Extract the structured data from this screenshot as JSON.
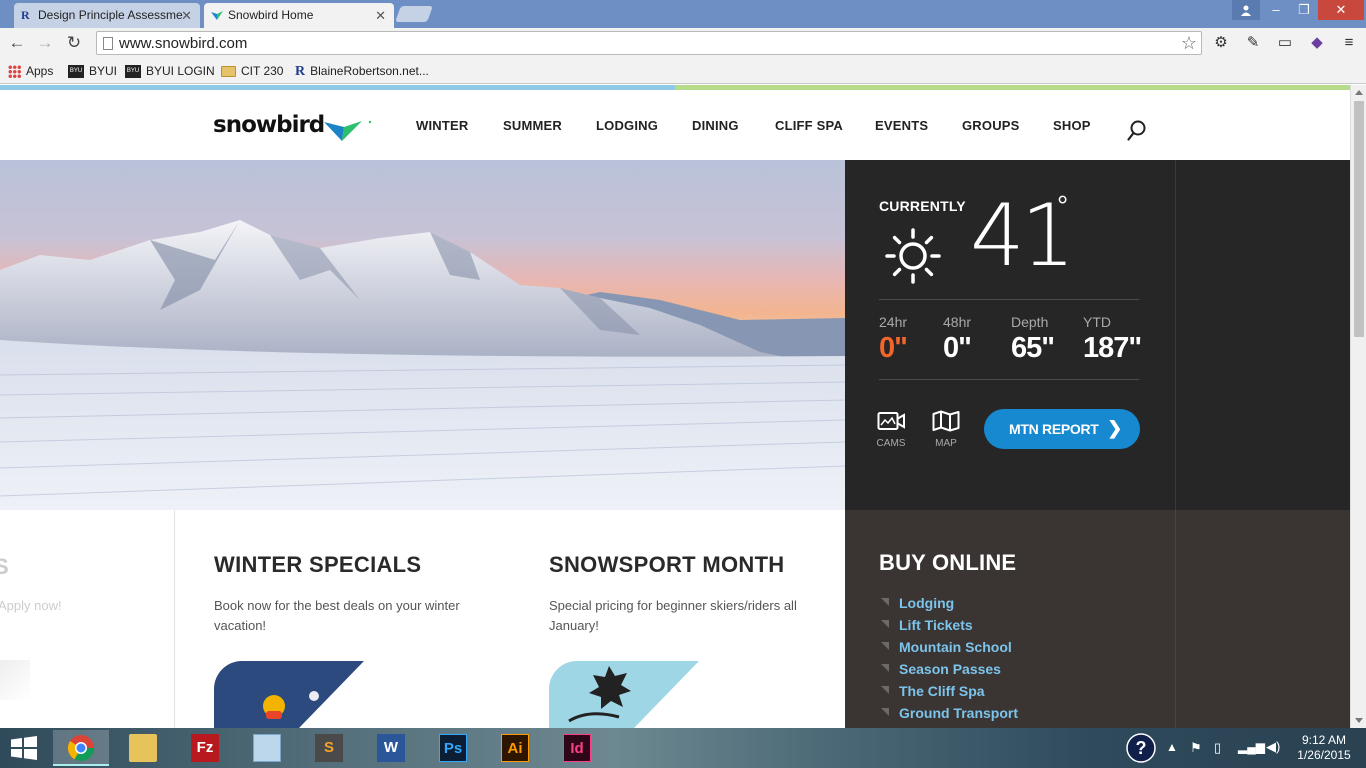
{
  "browser": {
    "tabs": [
      {
        "title": "Design Principle Assessme",
        "active": false
      },
      {
        "title": "Snowbird Home",
        "active": true
      }
    ],
    "url": "www.snowbird.com",
    "bookmarks": [
      {
        "label": "Apps",
        "icon": "apps-grid-icon"
      },
      {
        "label": "BYUI",
        "icon": "byui-logo-icon"
      },
      {
        "label": "BYUI LOGIN",
        "icon": "byui-logo-icon"
      },
      {
        "label": "CIT 230",
        "icon": "folder-icon"
      },
      {
        "label": "BlaineRobertson.net...",
        "icon": "r-logo-icon"
      }
    ]
  },
  "site": {
    "logo": "snowbird",
    "nav": [
      "WINTER",
      "SUMMER",
      "LODGING",
      "DINING",
      "CLIFF SPA",
      "EVENTS",
      "GROUPS",
      "SHOP"
    ]
  },
  "conditions": {
    "label": "CURRENTLY",
    "temperature": "41",
    "degree_symbol": "°",
    "weather_icon": "sun-icon",
    "stats": [
      {
        "label": "24hr",
        "value": "0\"",
        "highlight": true
      },
      {
        "label": "48hr",
        "value": "0\"",
        "highlight": false
      },
      {
        "label": "Depth",
        "value": "65\"",
        "highlight": false
      },
      {
        "label": "YTD",
        "value": "187\"",
        "highlight": false
      }
    ],
    "cams_label": "CAMS",
    "map_label": "MAP",
    "report_button": "MTN REPORT",
    "accent_color": "#f3652b",
    "button_color": "#1789d1"
  },
  "promos": {
    "peek": {
      "title": "S",
      "text": "Apply now!"
    },
    "items": [
      {
        "title": "WINTER SPECIALS",
        "text": "Book now for the best deals on your winter vacation!"
      },
      {
        "title": "SNOWSPORT MONTH",
        "text": "Special pricing for beginner skiers/riders all January!"
      }
    ]
  },
  "buy_online": {
    "title": "BUY ONLINE",
    "links": [
      "Lodging",
      "Lift Tickets",
      "Mountain School",
      "Season Passes",
      "The Cliff Spa",
      "Ground Transport"
    ]
  },
  "taskbar": {
    "apps": [
      "Chrome",
      "File Explorer",
      "FileZilla",
      "Box",
      "Sublime Text",
      "Word",
      "Photoshop",
      "Illustrator",
      "InDesign"
    ],
    "time": "9:12 AM",
    "date": "1/26/2015"
  }
}
